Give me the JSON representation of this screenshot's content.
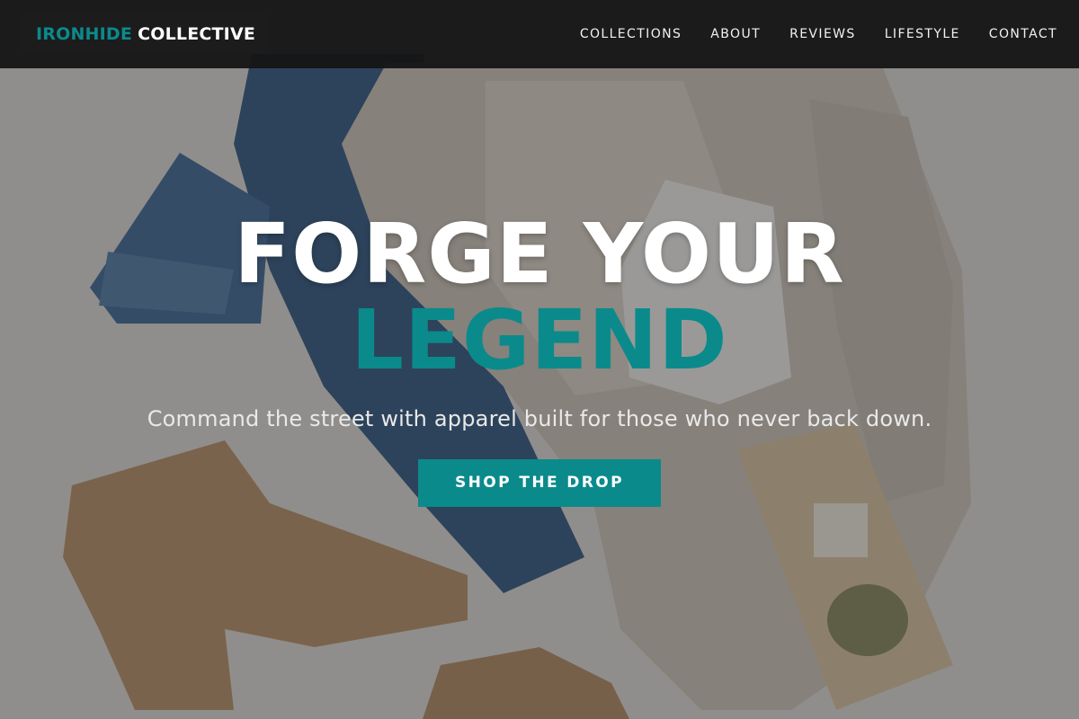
{
  "brand": {
    "accent": "IRONHIDE",
    "name": "COLLECTIVE"
  },
  "nav": {
    "items": [
      "COLLECTIONS",
      "ABOUT",
      "REVIEWS",
      "LIFESTYLE",
      "CONTACT"
    ]
  },
  "hero": {
    "line1": "FORGE YOUR",
    "line2": "LEGEND",
    "subtitle": "Command the street with apparel built for those who never back down.",
    "cta_label": "SHOP THE DROP"
  },
  "colors": {
    "accent": "#0b8a8c",
    "header_bg": "#161616",
    "text_light": "#ffffff"
  }
}
